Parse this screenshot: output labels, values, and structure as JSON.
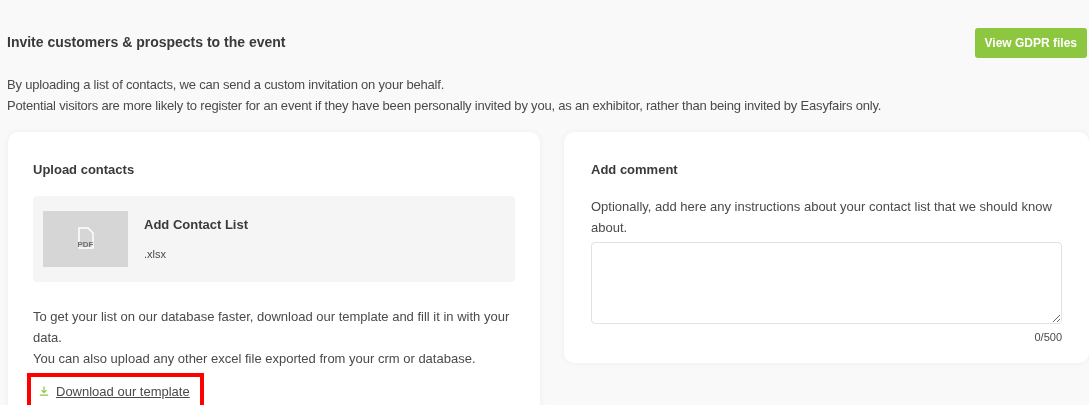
{
  "header": {
    "title": "Invite customers & prospects to the event",
    "button": "View GDPR files"
  },
  "intro": [
    "By uploading a list of contacts, we can send a custom invitation on your behalf.",
    "Potential visitors are more likely to register for an event if they have been personally invited by you, as an exhibitor, rather than being invited by Easyfairs only."
  ],
  "upload": {
    "title": "Upload contacts",
    "file_label": "PDF",
    "drop_title": "Add Contact List",
    "formats": ".xlsx",
    "help": [
      "To get your list on our database faster, download our template and fill it in with your data.",
      "You can also upload any other excel file exported from your crm or database."
    ],
    "download_link": "Download our template",
    "highlighted": true
  },
  "comment": {
    "title": "Add comment",
    "hint": "Optionally, add here any instructions about your contact list that we should know about.",
    "counter": "0/500"
  }
}
